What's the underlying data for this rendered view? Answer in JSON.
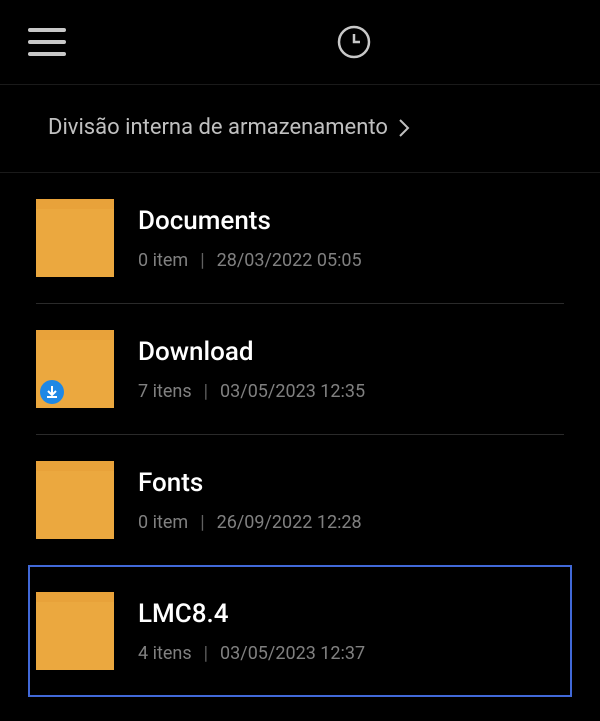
{
  "breadcrumb": {
    "label": "Divisão interna de armazenamento"
  },
  "files": [
    {
      "name": "Documents",
      "count": "0 item",
      "date": "28/03/2022 05:05",
      "badge": null,
      "selected": false
    },
    {
      "name": "Download",
      "count": "7 itens",
      "date": "03/05/2023 12:35",
      "badge": "download",
      "selected": false
    },
    {
      "name": "Fonts",
      "count": "0 item",
      "date": "26/09/2022 12:28",
      "badge": null,
      "selected": false
    },
    {
      "name": "LMC8.4",
      "count": "4 itens",
      "date": "03/05/2023 12:37",
      "badge": null,
      "selected": true
    }
  ]
}
